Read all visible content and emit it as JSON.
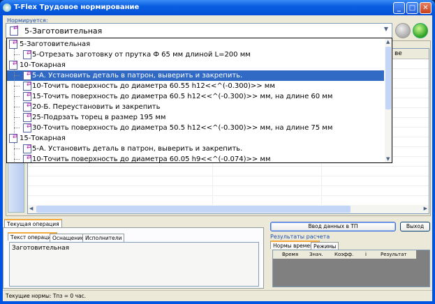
{
  "window": {
    "title": "T-Flex Трудовое нормирование",
    "minimize": "_",
    "maximize": "□",
    "close": "✕"
  },
  "header": {
    "norm_label": "Нормируется:",
    "selected": "5-Заготовительная"
  },
  "grid": {
    "visible_header": "ве"
  },
  "dropdown": {
    "items": [
      {
        "label": "5-Заготовительная",
        "level": 0
      },
      {
        "label": "5-Отрезать заготовку от прутка Ф 65 мм длиной L=200 мм",
        "level": 1
      },
      {
        "label": "10-Токарная",
        "level": 0
      },
      {
        "label": "5-А. Установить деталь в патрон, выверить и закрепить.",
        "level": 1,
        "selected": true
      },
      {
        "label": "10-Точить поверхность  до диаметра 60.55 h12<<^(-0.300)>> мм",
        "level": 1
      },
      {
        "label": "15-Точить поверхность  до диаметра 60.5 h12<<^(-0.300)>> мм, на длине 60 мм",
        "level": 1
      },
      {
        "label": "20-Б. Переустановить и закрепить",
        "level": 1
      },
      {
        "label": "25-Подрзать торец  в размер 195 мм",
        "level": 1
      },
      {
        "label": "30-Точить поверхность  до диаметра 50.5 h12<<^(-0.300)>> мм, на длине 75 мм",
        "level": 1
      },
      {
        "label": "15-Токарная",
        "level": 0
      },
      {
        "label": "5-А. Установить деталь в патрон, выверить и закрепить.",
        "level": 1
      },
      {
        "label": "10-Точить поверхность  до диаметра 60.05 h9<<^(-0.074)>> мм",
        "level": 1
      }
    ]
  },
  "current_op": {
    "tab": "Текущая операция",
    "subtabs": [
      "Текст операции",
      "Оснащение",
      "Исполнители"
    ],
    "text": "Заготовительная"
  },
  "buttons": {
    "enter_data": "Ввод данных в ТП",
    "exit": "Выход"
  },
  "results": {
    "title": "Результаты расчета",
    "tabs": [
      "Нормы времени",
      "Режимы"
    ],
    "columns": [
      "Время",
      "Знач.",
      "Коэфф.",
      "i",
      "Результат"
    ]
  },
  "status": {
    "text": "Текущие нормы:  Тпз = 0 час."
  },
  "colors": {
    "selection": "#316ac5",
    "titlebar": "#0054e3",
    "face": "#ece9d8"
  }
}
